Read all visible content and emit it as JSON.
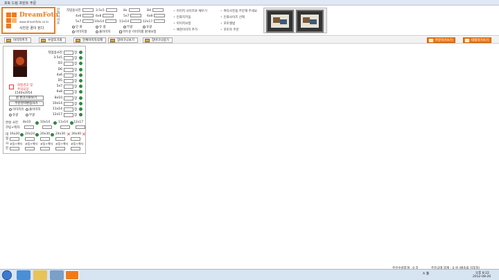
{
  "window": {
    "title": "포토 드림 프린트 주문"
  },
  "logo": {
    "brand": "DreamFoto",
    "url": "www.dreamfoto.co.kr",
    "slogan": "사진은 꿈이 된다"
  },
  "header": {
    "vertical_label": "인화사이즈",
    "sizes_col1": [
      "작업용사진",
      "4x6",
      "5x7"
    ],
    "sizes_col2": [
      "3.5x5",
      "6x8",
      "10x14"
    ],
    "sizes_col3": [
      "8x",
      "5x7",
      "11x14"
    ],
    "sizes_col4": [
      "B4",
      "6x8",
      "12x17"
    ],
    "options_row1": [
      "인 화",
      "유 광",
      "무광",
      "유광"
    ],
    "options_row2": [
      "이미지형",
      "풀이미지",
      "어두운 이미지를 밝게보정"
    ],
    "links_col1": [
      "이미지 사이즈로 채우기",
      "인화지키움",
      "이미지보정",
      "배경이미지 추가"
    ],
    "links_col2": [
      "여유사진을 주문해 주세요",
      "인화사이즈 선택",
      "포토앨범",
      "포토북 주문"
    ]
  },
  "toolbar": {
    "buttons": [
      "이미지추가",
      "수량초기화",
      "전체이미지삭제",
      "장바구니보기",
      "장바구니담기"
    ],
    "right_buttons": [
      "주문하기보기",
      "대형하기보기"
    ]
  },
  "panel": {
    "selected_label": "1/1 선택됨 원본",
    "resolution": "1540x2054",
    "warning_line1": "화질경고 및",
    "warning_line2": "주의요망",
    "btn_preview": "원 본크기로보기",
    "btn_crop": "부분영역편집하기",
    "opt1": "이미지유",
    "opt2": "풀이미지",
    "opt3": "유광",
    "opt4": "무광",
    "sizes": [
      {
        "label": "작업용사진",
        "unit": "장"
      },
      {
        "label": "3.5x5",
        "unit": "장"
      },
      {
        "label": "D3",
        "unit": "장"
      },
      {
        "label": "D6",
        "unit": "장"
      },
      {
        "label": "4x6",
        "unit": "장"
      },
      {
        "label": "D5",
        "unit": "장"
      },
      {
        "label": "5x7",
        "unit": "장"
      },
      {
        "label": "6x8",
        "unit": "장"
      },
      {
        "label": "8x10",
        "unit": "장"
      },
      {
        "label": "10x14",
        "unit": "장"
      },
      {
        "label": "11x14",
        "unit": "장"
      },
      {
        "label": "12x17",
        "unit": "장"
      }
    ],
    "frame_label": "완성 사진",
    "frame_sizes": [
      "8x10",
      "10x14",
      "11x14",
      "12x17"
    ],
    "frame_qty_label": "코팅+액자",
    "large_label": "대형",
    "large_sizes": [
      "16x20",
      "20x24",
      "20x30",
      "24x30",
      "30x40"
    ],
    "large_qty_labels": [
      "코팅+액자",
      "코팅+액자",
      "코팅+액자",
      "코팅+액자",
      "코팅+액자"
    ],
    "side_labels": [
      "대",
      "형",
      "사",
      "진"
    ]
  },
  "status": {
    "total_qty": "주문수량합계 : 0 장",
    "total_price": "주문금액 합계 : 0 원 (배송료 미포함)"
  },
  "taskbar": {
    "ime": "A 漢",
    "time": "오후 8:22",
    "date": "2012-08-26"
  }
}
